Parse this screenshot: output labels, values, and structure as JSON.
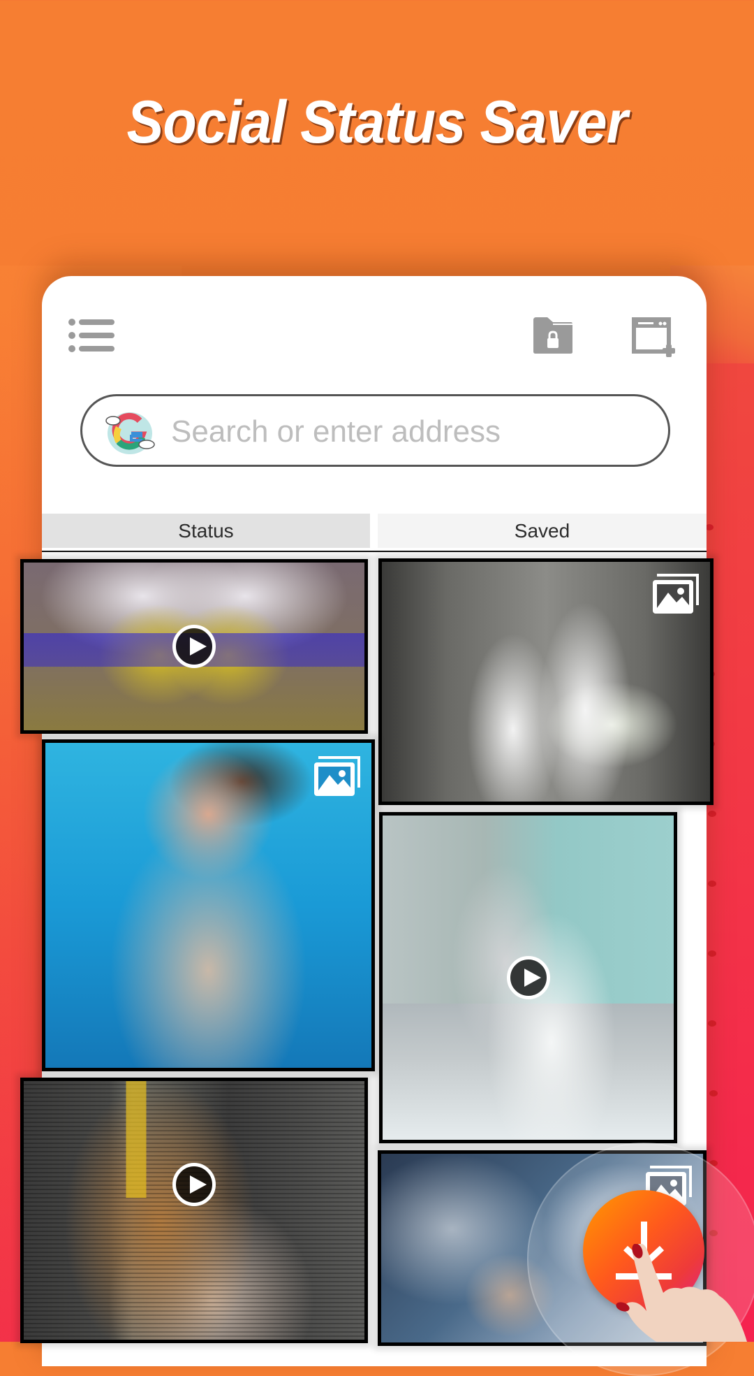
{
  "app": {
    "title": "Social Status Saver"
  },
  "toolbar": {
    "menu_icon": "list-icon",
    "private_folder_icon": "folder-lock-icon",
    "new_tab_icon": "new-tab-icon"
  },
  "search": {
    "placeholder": "Search or enter address",
    "value": "",
    "engine_icon": "google-logo-icon"
  },
  "tabs": [
    {
      "label": "Status",
      "selected": true
    },
    {
      "label": "Saved",
      "selected": false
    }
  ],
  "tiles": [
    {
      "type": "video",
      "badge": "play-icon",
      "description": "two friends lying on ground making heart hands"
    },
    {
      "type": "image",
      "badge": "gallery-icon",
      "description": "two women in white ao dai with bicycle and flowers"
    },
    {
      "type": "image",
      "badge": "gallery-icon",
      "description": "woman in swimming pool"
    },
    {
      "type": "video",
      "badge": "play-icon",
      "description": "couple on rooftop, man covering woman's eyes"
    },
    {
      "type": "video",
      "badge": "play-icon",
      "description": "woman with long hair looking down"
    },
    {
      "type": "image",
      "badge": "gallery-icon",
      "description": "woman blowing snow from mitten"
    }
  ],
  "fab": {
    "icon": "download-icon",
    "action": "download"
  },
  "colors": {
    "background_top": "#f67e32",
    "background_bottom": "#f32f4b",
    "fab_gradient_start": "#ff9a00",
    "fab_gradient_end": "#e0238a",
    "icon_gray": "#9a9a9a",
    "tab_selected": "#e2e2e2",
    "tab_unselected": "#f4f4f4"
  }
}
